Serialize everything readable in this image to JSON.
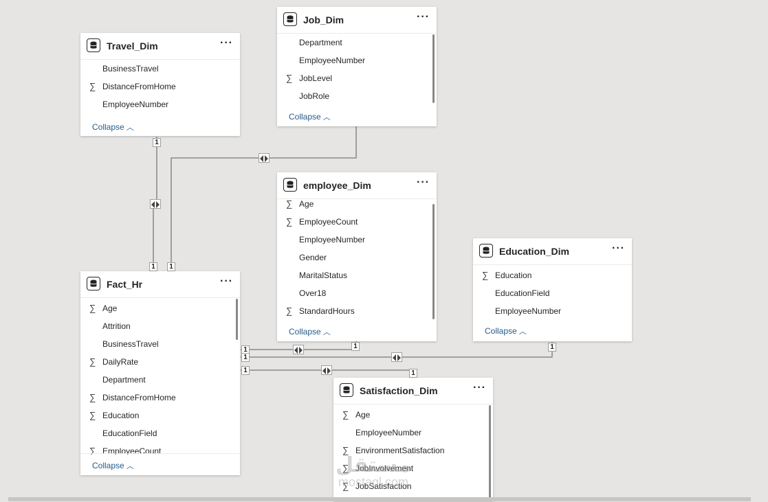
{
  "tables": {
    "travel": {
      "title": "Travel_Dim",
      "fields": [
        {
          "name": "BusinessTravel",
          "sigma": false
        },
        {
          "name": "DistanceFromHome",
          "sigma": true
        },
        {
          "name": "EmployeeNumber",
          "sigma": false
        }
      ],
      "collapse": "Collapse"
    },
    "job": {
      "title": "Job_Dim",
      "fields": [
        {
          "name": "Department",
          "sigma": false
        },
        {
          "name": "EmployeeNumber",
          "sigma": false
        },
        {
          "name": "JobLevel",
          "sigma": true
        },
        {
          "name": "JobRole",
          "sigma": false
        }
      ],
      "collapse": "Collapse"
    },
    "employee": {
      "title": "employee_Dim",
      "fields": [
        {
          "name": "Age",
          "sigma": true
        },
        {
          "name": "EmployeeCount",
          "sigma": true
        },
        {
          "name": "EmployeeNumber",
          "sigma": false
        },
        {
          "name": "Gender",
          "sigma": false
        },
        {
          "name": "MaritalStatus",
          "sigma": false
        },
        {
          "name": "Over18",
          "sigma": false
        },
        {
          "name": "StandardHours",
          "sigma": true
        }
      ],
      "collapse": "Collapse"
    },
    "education": {
      "title": "Education_Dim",
      "fields": [
        {
          "name": "Education",
          "sigma": true
        },
        {
          "name": "EducationField",
          "sigma": false
        },
        {
          "name": "EmployeeNumber",
          "sigma": false
        }
      ],
      "collapse": "Collapse"
    },
    "fact": {
      "title": "Fact_Hr",
      "fields": [
        {
          "name": "Age",
          "sigma": true
        },
        {
          "name": "Attrition",
          "sigma": false
        },
        {
          "name": "BusinessTravel",
          "sigma": false
        },
        {
          "name": "DailyRate",
          "sigma": true
        },
        {
          "name": "Department",
          "sigma": false
        },
        {
          "name": "DistanceFromHome",
          "sigma": true
        },
        {
          "name": "Education",
          "sigma": true
        },
        {
          "name": "EducationField",
          "sigma": false
        },
        {
          "name": "EmployeeCount",
          "sigma": true
        }
      ],
      "collapse": "Collapse"
    },
    "satisfaction": {
      "title": "Satisfaction_Dim",
      "fields": [
        {
          "name": "Age",
          "sigma": true
        },
        {
          "name": "EmployeeNumber",
          "sigma": false
        },
        {
          "name": "EnvironmentSatisfaction",
          "sigma": true
        },
        {
          "name": "JobInvolvement",
          "sigma": true
        },
        {
          "name": "JobSatisfaction",
          "sigma": true
        }
      ]
    }
  },
  "cardinality": {
    "one": "1"
  },
  "icons": {
    "table": "table-database-icon",
    "more": "more-options-icon",
    "sigma": "sum-icon",
    "collapse_chevron": "chevron-up-icon",
    "filter": "bidirectional-filter-icon"
  },
  "sigma_glyph": "∑",
  "more_glyph": "···",
  "watermark": {
    "main": "مستقل",
    "sub": "mostaql.com"
  },
  "colors": {
    "canvas": "#e6e5e3",
    "link": "#7a7876",
    "collapse_text": "#255b8a"
  }
}
